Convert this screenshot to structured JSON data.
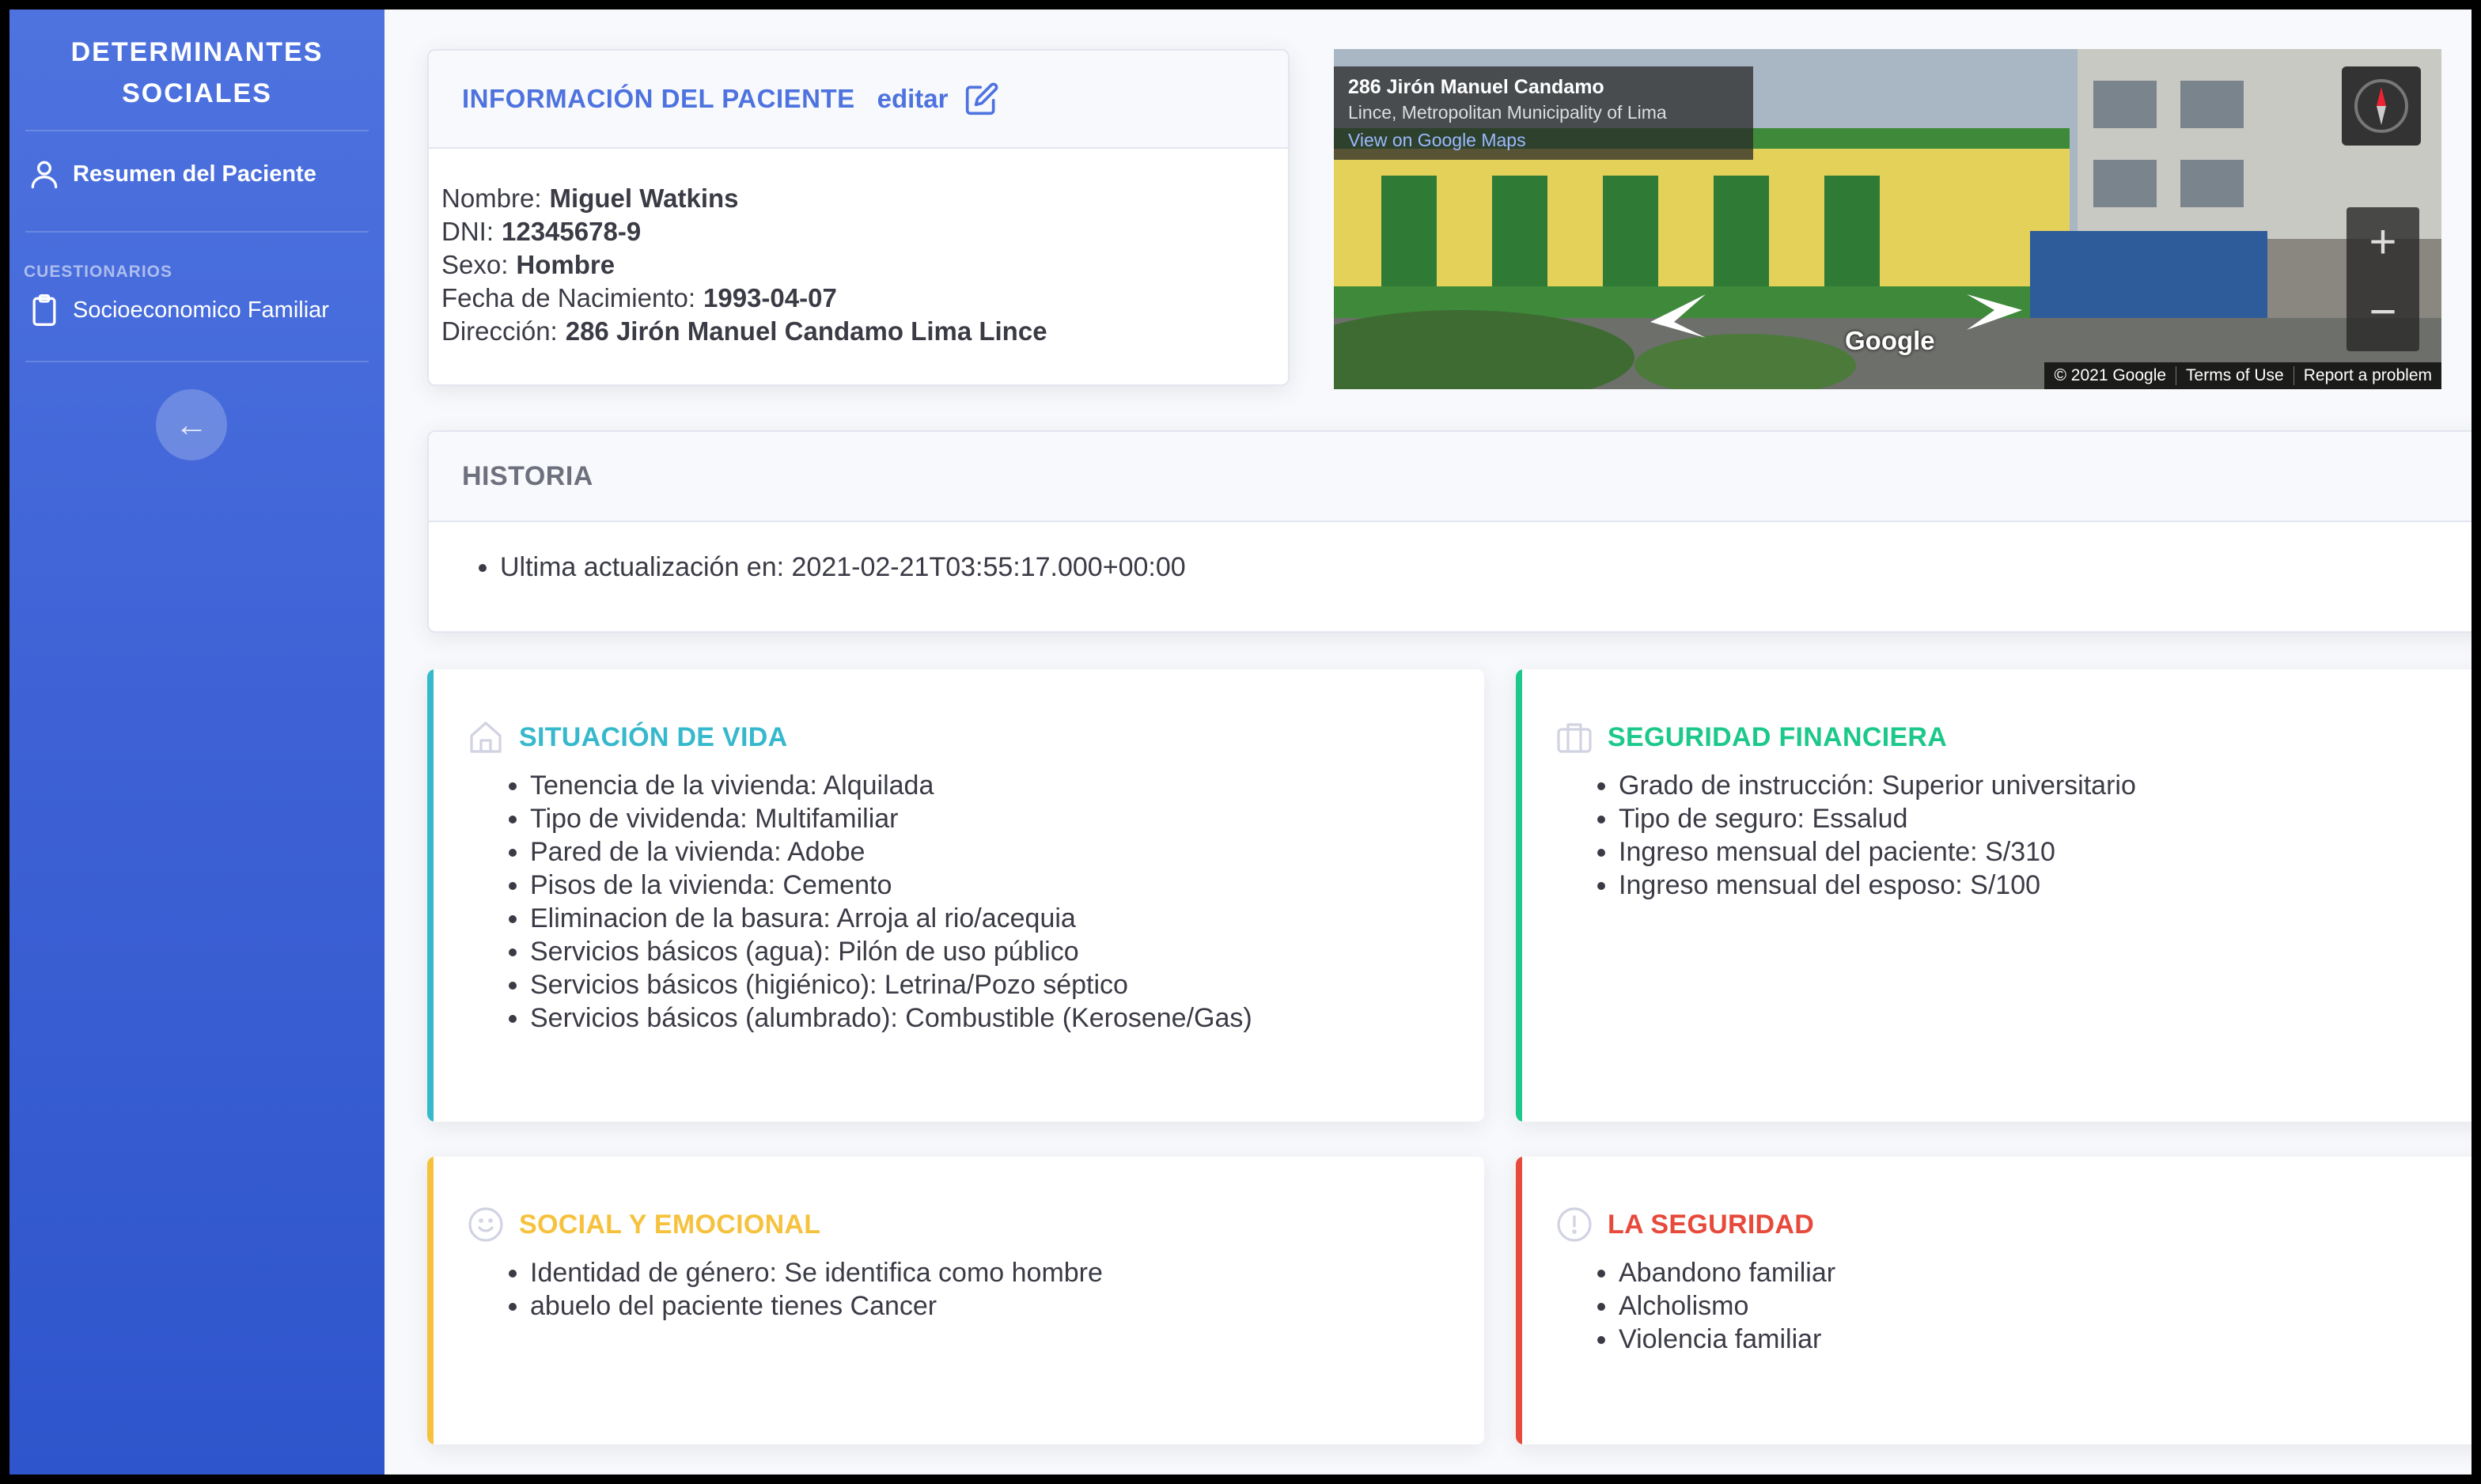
{
  "sidebar": {
    "brand_line1": "DETERMINANTES",
    "brand_line2": "SOCIALES",
    "summary_label": "Resumen del Paciente",
    "heading": "CUESTIONARIOS",
    "questionnaire_label": "Socioeconomico Familiar",
    "toggle_arrow": "←"
  },
  "patient": {
    "header_title": "INFORMACIÓN DEL PACIENTE",
    "edit_label": "editar",
    "fields": [
      {
        "label": "Nombre:",
        "value": "Miguel Watkins"
      },
      {
        "label": "DNI:",
        "value": "12345678-9"
      },
      {
        "label": "Sexo:",
        "value": "Hombre"
      },
      {
        "label": "Fecha de Nacimiento:",
        "value": "1993-04-07"
      },
      {
        "label": "Dirección:",
        "value": "286 Jirón Manuel Candamo Lima Lince"
      }
    ]
  },
  "map": {
    "address": "286 Jirón Manuel Candamo",
    "locality": "Lince, Metropolitan Municipality of Lima",
    "view_link": "View on Google Maps",
    "watermark": "Google",
    "copyright": "© 2021 Google",
    "terms": "Terms of Use",
    "report": "Report a problem",
    "zoom_in": "+",
    "zoom_out": "−"
  },
  "history": {
    "title": "HISTORIA",
    "entry": "Ultima actualización en: 2021-02-21T03:55:17.000+00:00"
  },
  "sections": {
    "vida": {
      "title": "SITUACIÓN DE VIDA",
      "color": "#36b9cc",
      "icon": "home-icon",
      "items": [
        "Tenencia de la vivienda: Alquilada",
        "Tipo de vividenda: Multifamiliar",
        "Pared de la vivienda: Adobe",
        "Pisos de la vivienda: Cemento",
        "Eliminacion de la basura: Arroja al rio/acequia",
        "Servicios básicos (agua): Pilón de uso público",
        "Servicios básicos (higiénico): Letrina/Pozo séptico",
        "Servicios básicos (alumbrado): Combustible (Kerosene/Gas)"
      ]
    },
    "financiera": {
      "title": "SEGURIDAD FINANCIERA",
      "color": "#1cc88a",
      "icon": "briefcase-icon",
      "items": [
        "Grado de instrucción: Superior universitario",
        "Tipo de seguro: Essalud",
        "Ingreso mensual del paciente: S/310",
        "Ingreso mensual del esposo: S/100"
      ]
    },
    "social": {
      "title": "SOCIAL Y EMOCIONAL",
      "color": "#f6c23e",
      "icon": "smile-icon",
      "items": [
        "Identidad de género: Se identifica como hombre",
        "abuelo del paciente tienes Cancer"
      ]
    },
    "seguridad": {
      "title": "LA SEGURIDAD",
      "color": "#e74a3b",
      "icon": "alert-circle-icon",
      "items": [
        "Abandono familiar",
        "Alcholismo",
        "Violencia familiar"
      ]
    }
  }
}
